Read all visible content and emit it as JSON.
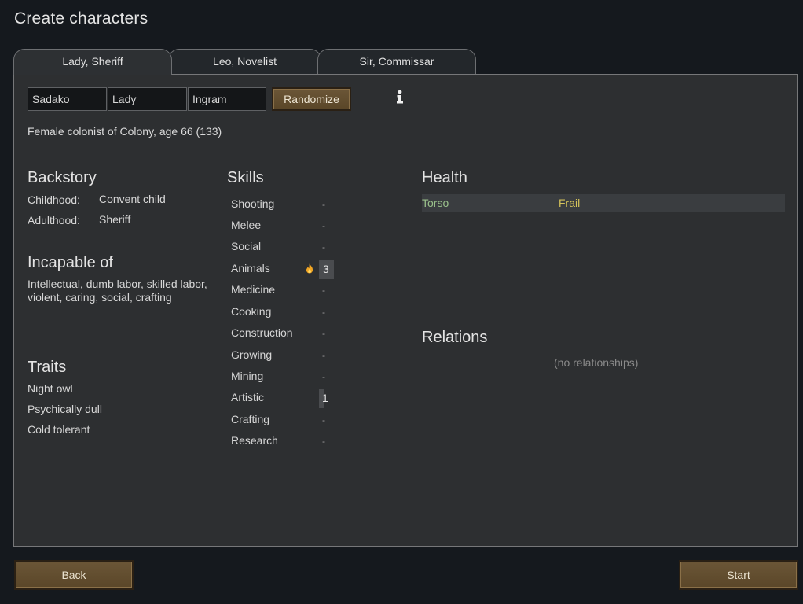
{
  "title": "Create characters",
  "tabs": [
    {
      "label": "Lady, Sheriff",
      "active": true
    },
    {
      "label": "Leo, Novelist",
      "active": false
    },
    {
      "label": "Sir, Commissar",
      "active": false
    }
  ],
  "name": {
    "first": "Sadako",
    "nick": "Lady",
    "last": "Ingram",
    "randomize_label": "Randomize"
  },
  "description": "Female colonist of Colony, age 66 (133)",
  "backstory": {
    "title": "Backstory",
    "childhood_label": "Childhood:",
    "childhood_value": "Convent child",
    "adulthood_label": "Adulthood:",
    "adulthood_value": "Sheriff"
  },
  "incapable": {
    "title": "Incapable of",
    "text": "Intellectual, dumb labor, skilled labor, violent, caring, social, crafting"
  },
  "traits": {
    "title": "Traits",
    "items": [
      "Night owl",
      "Psychically dull",
      "Cold tolerant"
    ]
  },
  "skills": {
    "title": "Skills",
    "items": [
      {
        "name": "Shooting",
        "level": "-",
        "bar": 0,
        "passion": false
      },
      {
        "name": "Melee",
        "level": "-",
        "bar": 0,
        "passion": false
      },
      {
        "name": "Social",
        "level": "-",
        "bar": 0,
        "passion": false
      },
      {
        "name": "Animals",
        "level": "3",
        "bar": 3,
        "passion": true
      },
      {
        "name": "Medicine",
        "level": "-",
        "bar": 0,
        "passion": false
      },
      {
        "name": "Cooking",
        "level": "-",
        "bar": 0,
        "passion": false
      },
      {
        "name": "Construction",
        "level": "-",
        "bar": 0,
        "passion": false
      },
      {
        "name": "Growing",
        "level": "-",
        "bar": 0,
        "passion": false
      },
      {
        "name": "Mining",
        "level": "-",
        "bar": 0,
        "passion": false
      },
      {
        "name": "Artistic",
        "level": "1",
        "bar": 1,
        "passion": false
      },
      {
        "name": "Crafting",
        "level": "-",
        "bar": 0,
        "passion": false
      },
      {
        "name": "Research",
        "level": "-",
        "bar": 0,
        "passion": false
      }
    ]
  },
  "health": {
    "title": "Health",
    "rows": [
      {
        "part": "Torso",
        "condition": "Frail"
      }
    ]
  },
  "relations": {
    "title": "Relations",
    "empty_text": "(no relationships)"
  },
  "footer": {
    "back_label": "Back",
    "start_label": "Start"
  },
  "colors": {
    "health_part": "#99c08a",
    "health_condition": "#d4c35a",
    "button_brown": "#6b5637"
  },
  "icons": {
    "info": "info-icon",
    "passion": "flame-icon"
  }
}
